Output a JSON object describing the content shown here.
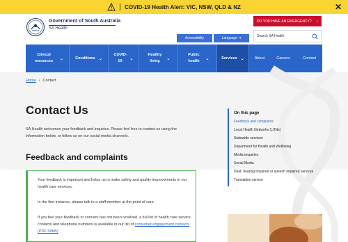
{
  "alert": {
    "text": "COVID-19 Health Alert: VIC, NSW, QLD & NZ",
    "close_icon": "close-icon",
    "warning_icon": "warning-icon",
    "color": "#f8d531"
  },
  "header": {
    "logo_line1": "Government of South Australia",
    "logo_line2": "SA Health",
    "emergency_label": "DO YOU HAVE AN EMERGENCY?",
    "emergency_chevron": "›",
    "accessibility_label": "Accessibility",
    "language_label": "Language",
    "language_chevron": "▾",
    "search_placeholder": "Search SA Health"
  },
  "nav": {
    "items": [
      {
        "label": "Clinical resources",
        "chevron": "⌄"
      },
      {
        "label": "Conditions",
        "chevron": "⌄"
      },
      {
        "label": "COVID-19",
        "chevron": "⌄"
      },
      {
        "label": "Healthy living",
        "chevron": "⌄"
      },
      {
        "label": "Public health",
        "chevron": "⌄"
      },
      {
        "label": "Services",
        "chevron": "⌄"
      },
      {
        "label": "About"
      },
      {
        "label": "Careers"
      },
      {
        "label": "Contact"
      }
    ]
  },
  "breadcrumb": {
    "home": "Home",
    "separator": "›",
    "current": "Contact"
  },
  "main": {
    "title": "Contact Us",
    "intro": "SA Health welcomes your feedback and inquiries. Please feel free to contact us using the information below, or follow us on our social media channels.",
    "section_title": "Feedback and complaints",
    "box": {
      "p1": "Your feedback is important and helps us to make safety and quality improvements in our health care services.",
      "p2": "In the first instance, please talk to a staff member at the point of care.",
      "p3": "If you feel your feedback or concern has not been resolved, a full list of health care service contacts and telephone numbers is available in our list of",
      "link": "consumer engagement contacts (PDF 58KB)"
    }
  },
  "toc": {
    "heading": "On this page",
    "items": [
      "Feedback and complaints",
      "Local Health Networks (LHNs)",
      "Statewide services",
      "Department for Health and Wellbeing",
      "Media enquiries",
      "Social Media",
      "Deaf, hearing impaired or speech impaired services",
      "Translation service"
    ]
  },
  "colors": {
    "brand_blue": "#2a66c9",
    "emergency_red": "#c8102e",
    "callout_green": "#4caf50"
  }
}
